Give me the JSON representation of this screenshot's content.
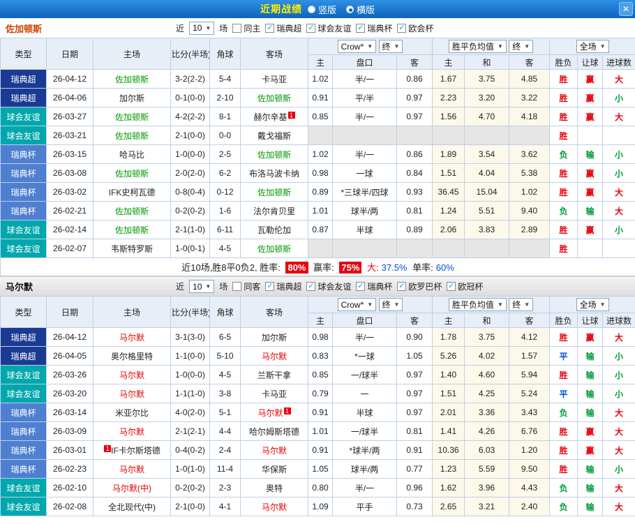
{
  "icons": {
    "close": "✕",
    "dropdown": "▼",
    "check": "✓"
  },
  "type_colors": {
    "瑞典超": "#1a3a94",
    "球会友谊": "#00a7ad",
    "瑞典杯": "#4e7fd0"
  },
  "result_colors": {
    "胜": "#e8000d",
    "平": "#0050dc",
    "负": "#009a3c",
    "赢": "#e8000d",
    "输": "#009a3c",
    "大": "#e8000d",
    "小": "#009a3c"
  },
  "titlebar": {
    "title": "近期战绩",
    "vertical": "竖版",
    "horizontal": "横版",
    "selected": "横版"
  },
  "sections": [
    {
      "team": "佐加顿斯",
      "focus_color": "#009a00",
      "filter": {
        "near": "近",
        "count": "10",
        "unit": "场",
        "same": "同主",
        "same_checked": false,
        "leagues": [
          "瑞典超",
          "球会友谊",
          "瑞典杯",
          "欧会杯"
        ]
      },
      "header": {
        "type": "类型",
        "date": "日期",
        "home": "主场",
        "score": "比分(半场)",
        "corner": "角球",
        "away": "客场",
        "odds_source": "Crow*",
        "odds_final": "终",
        "odds_cols": [
          "主",
          "盘口",
          "客"
        ],
        "avg_source": "胜平负均值",
        "avg_final": "终",
        "avg_cols": [
          "主",
          "和",
          "客"
        ],
        "full": "全场",
        "result_cols": [
          "胜负",
          "让球",
          "进球数"
        ]
      },
      "rows": [
        {
          "type": "瑞典超",
          "date": "26-04-12",
          "home": "佐加顿斯",
          "home_focus": true,
          "score": "3-2(2-2)",
          "corner": "5-4",
          "away": "卡马亚",
          "odds": [
            "1.02",
            "半/一",
            "0.86"
          ],
          "avg": [
            "1.67",
            "3.75",
            "4.85"
          ],
          "results": [
            "胜",
            "赢",
            "大"
          ]
        },
        {
          "type": "瑞典超",
          "date": "26-04-06",
          "home": "加尔斯",
          "score": "0-1(0-0)",
          "corner": "2-10",
          "away": "佐加顿斯",
          "away_focus": true,
          "odds": [
            "0.91",
            "平/半",
            "0.97"
          ],
          "avg": [
            "2.23",
            "3.20",
            "3.22"
          ],
          "results": [
            "胜",
            "赢",
            "小"
          ]
        },
        {
          "type": "球会友谊",
          "date": "26-03-27",
          "home": "佐加顿斯",
          "home_focus": true,
          "score": "4-2(2-2)",
          "corner": "8-1",
          "away": "赫尔辛基",
          "away_badge": "1",
          "odds": [
            "0.85",
            "半/一",
            "0.97"
          ],
          "avg": [
            "1.56",
            "4.70",
            "4.18"
          ],
          "results": [
            "胜",
            "赢",
            "大"
          ]
        },
        {
          "type": "球会友谊",
          "date": "26-03-21",
          "home": "佐加顿斯",
          "home_focus": true,
          "score": "2-1(0-0)",
          "corner": "0-0",
          "away": "戴戈福斯",
          "odds": [
            "",
            "",
            ""
          ],
          "avg": [
            "",
            "",
            ""
          ],
          "results": [
            "胜",
            "",
            ""
          ],
          "no_odds": true
        },
        {
          "type": "瑞典杯",
          "date": "26-03-15",
          "home": "哈马比",
          "score": "1-0(0-0)",
          "corner": "2-5",
          "away": "佐加顿斯",
          "away_focus": true,
          "odds": [
            "1.02",
            "半/一",
            "0.86"
          ],
          "avg": [
            "1.89",
            "3.54",
            "3.62"
          ],
          "results": [
            "负",
            "输",
            "小"
          ]
        },
        {
          "type": "瑞典杯",
          "date": "26-03-08",
          "home": "佐加顿斯",
          "home_focus": true,
          "score": "2-0(2-0)",
          "corner": "6-2",
          "away": "布洛马波卡纳",
          "odds": [
            "0.98",
            "一球",
            "0.84"
          ],
          "avg": [
            "1.51",
            "4.04",
            "5.38"
          ],
          "results": [
            "胜",
            "赢",
            "小"
          ]
        },
        {
          "type": "瑞典杯",
          "date": "26-03-02",
          "home": "IFK史柯瓦德",
          "score": "0-8(0-4)",
          "corner": "0-12",
          "away": "佐加顿斯",
          "away_focus": true,
          "odds": [
            "0.89",
            "*三球半/四球",
            "0.93"
          ],
          "avg": [
            "36.45",
            "15.04",
            "1.02"
          ],
          "results": [
            "胜",
            "赢",
            "大"
          ]
        },
        {
          "type": "瑞典杯",
          "date": "26-02-21",
          "home": "佐加顿斯",
          "home_focus": true,
          "score": "0-2(0-2)",
          "corner": "1-6",
          "away": "法尔肯贝里",
          "odds": [
            "1.01",
            "球半/两",
            "0.81"
          ],
          "avg": [
            "1.24",
            "5.51",
            "9.40"
          ],
          "results": [
            "负",
            "输",
            "大"
          ]
        },
        {
          "type": "球会友谊",
          "date": "26-02-14",
          "home": "佐加顿斯",
          "home_focus": true,
          "score": "2-1(1-0)",
          "corner": "6-11",
          "away": "瓦勒伦加",
          "odds": [
            "0.87",
            "半球",
            "0.89"
          ],
          "avg": [
            "2.06",
            "3.83",
            "2.89"
          ],
          "results": [
            "胜",
            "赢",
            "小"
          ]
        },
        {
          "type": "球会友谊",
          "date": "26-02-07",
          "home": "韦斯特罗斯",
          "score": "1-0(0-1)",
          "corner": "4-5",
          "away": "佐加顿斯",
          "away_focus": true,
          "odds": [
            "",
            "",
            ""
          ],
          "avg": [
            "",
            "",
            ""
          ],
          "results": [
            "胜",
            "",
            ""
          ],
          "no_odds": true
        }
      ],
      "summary": {
        "text": "近10场,胜8平0负2, 胜率:",
        "win_rate": "80%",
        "mid": "赢率:",
        "handicap_rate": "75%",
        "big": "大:",
        "big_rate": "37.5%",
        "odd": "单率:",
        "odd_rate": "60%"
      }
    },
    {
      "team": "马尔默",
      "focus_color": "#e60000",
      "filter": {
        "near": "近",
        "count": "10",
        "unit": "场",
        "same": "同客",
        "same_checked": false,
        "leagues": [
          "瑞典超",
          "球会友谊",
          "瑞典杯",
          "欧罗巴杯",
          "欧冠杯"
        ]
      },
      "header": {
        "type": "类型",
        "date": "日期",
        "home": "主场",
        "score": "比分(半场)",
        "corner": "角球",
        "away": "客场",
        "odds_source": "Crow*",
        "odds_final": "终",
        "odds_cols": [
          "主",
          "盘口",
          "客"
        ],
        "avg_source": "胜平负均值",
        "avg_final": "终",
        "avg_cols": [
          "主",
          "和",
          "客"
        ],
        "full": "全场",
        "result_cols": [
          "胜负",
          "让球",
          "进球数"
        ]
      },
      "rows": [
        {
          "type": "瑞典超",
          "date": "26-04-12",
          "home": "马尔默",
          "home_focus": true,
          "score": "3-1(3-0)",
          "corner": "6-5",
          "away": "加尔斯",
          "odds": [
            "0.98",
            "半/一",
            "0.90"
          ],
          "avg": [
            "1.78",
            "3.75",
            "4.12"
          ],
          "results": [
            "胜",
            "赢",
            "大"
          ]
        },
        {
          "type": "瑞典超",
          "date": "26-04-05",
          "home": "奥尔格里特",
          "score": "1-1(0-0)",
          "corner": "5-10",
          "away": "马尔默",
          "away_focus": true,
          "odds": [
            "0.83",
            "*一球",
            "1.05"
          ],
          "avg": [
            "5.26",
            "4.02",
            "1.57"
          ],
          "results": [
            "平",
            "输",
            "小"
          ]
        },
        {
          "type": "球会友谊",
          "date": "26-03-26",
          "home": "马尔默",
          "home_focus": true,
          "score": "1-0(0-0)",
          "corner": "4-5",
          "away": "兰斯干拿",
          "odds": [
            "0.85",
            "一/球半",
            "0.97"
          ],
          "avg": [
            "1.40",
            "4.60",
            "5.94"
          ],
          "results": [
            "胜",
            "输",
            "小"
          ]
        },
        {
          "type": "球会友谊",
          "date": "26-03-20",
          "home": "马尔默",
          "home_focus": true,
          "score": "1-1(1-0)",
          "corner": "3-8",
          "away": "卡马亚",
          "odds": [
            "0.79",
            "一",
            "0.97"
          ],
          "avg": [
            "1.51",
            "4.25",
            "5.24"
          ],
          "results": [
            "平",
            "输",
            "小"
          ]
        },
        {
          "type": "瑞典杯",
          "date": "26-03-14",
          "home": "米亚尔比",
          "score": "4-0(2-0)",
          "corner": "5-1",
          "away": "马尔默",
          "away_focus": true,
          "away_badge": "1",
          "odds": [
            "0.91",
            "半球",
            "0.97"
          ],
          "avg": [
            "2.01",
            "3.36",
            "3.43"
          ],
          "results": [
            "负",
            "输",
            "大"
          ]
        },
        {
          "type": "瑞典杯",
          "date": "26-03-09",
          "home": "马尔默",
          "home_focus": true,
          "score": "2-1(2-1)",
          "corner": "4-4",
          "away": "哈尔姆斯塔德",
          "odds": [
            "1.01",
            "一/球半",
            "0.81"
          ],
          "avg": [
            "1.41",
            "4.26",
            "6.76"
          ],
          "results": [
            "胜",
            "赢",
            "大"
          ]
        },
        {
          "type": "瑞典杯",
          "date": "26-03-01",
          "home": "IF卡尔斯塔德",
          "home_badge": "1",
          "home_badge_pos": "before",
          "score": "0-4(0-2)",
          "corner": "2-4",
          "away": "马尔默",
          "away_focus": true,
          "odds": [
            "0.91",
            "*球半/两",
            "0.91"
          ],
          "avg": [
            "10.36",
            "6.03",
            "1.20"
          ],
          "results": [
            "胜",
            "赢",
            "大"
          ]
        },
        {
          "type": "瑞典杯",
          "date": "26-02-23",
          "home": "马尔默",
          "home_focus": true,
          "score": "1-0(1-0)",
          "corner": "11-4",
          "away": "华保斯",
          "odds": [
            "1.05",
            "球半/两",
            "0.77"
          ],
          "avg": [
            "1.23",
            "5.59",
            "9.50"
          ],
          "results": [
            "胜",
            "输",
            "小"
          ]
        },
        {
          "type": "球会友谊",
          "date": "26-02-10",
          "home": "马尔默(中)",
          "home_focus": true,
          "score": "0-2(0-2)",
          "corner": "2-3",
          "away": "奥特",
          "odds": [
            "0.80",
            "半/一",
            "0.96"
          ],
          "avg": [
            "1.62",
            "3.96",
            "4.43"
          ],
          "results": [
            "负",
            "输",
            "大"
          ]
        },
        {
          "type": "球会友谊",
          "date": "26-02-08",
          "home": "全北现代(中)",
          "score": "2-1(0-0)",
          "corner": "4-1",
          "away": "马尔默",
          "away_focus": true,
          "odds": [
            "1.09",
            "平手",
            "0.73"
          ],
          "avg": [
            "2.65",
            "3.21",
            "2.40"
          ],
          "results": [
            "负",
            "输",
            "大"
          ]
        }
      ]
    }
  ]
}
